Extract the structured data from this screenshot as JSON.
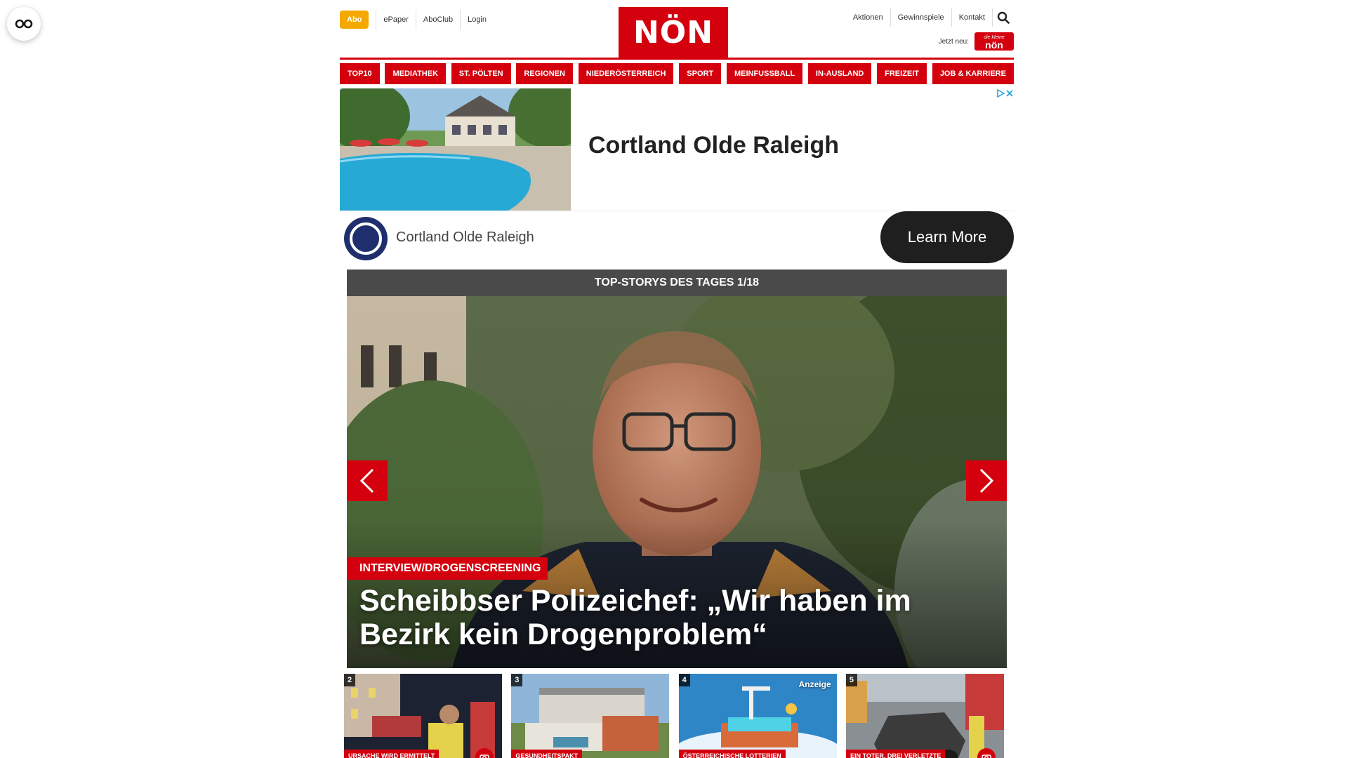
{
  "header": {
    "abo_label": "Abo",
    "left_links": [
      "ePaper",
      "AboClub",
      "Login"
    ],
    "logo_text": "NÖN",
    "right_links": [
      "Aktionen",
      "Gewinnspiele",
      "Kontakt"
    ],
    "jetzt_label": "Jetzt neu:",
    "jetzt_logo_top": "die kleine",
    "jetzt_logo_bottom": "nön"
  },
  "nav": {
    "items": [
      "TOP10",
      "MEDIATHEK",
      "ST. PÖLTEN",
      "REGIONEN",
      "NIEDERÖSTERREICH",
      "SPORT",
      "MEINFUSSBALL",
      "IN-AUSLAND",
      "FREIZEIT",
      "JOB & KARRIERE"
    ]
  },
  "ad": {
    "headline": "Cortland Olde Raleigh",
    "brand": "Cortland Olde Raleigh",
    "cta": "Learn More"
  },
  "top_stories": {
    "heading": "TOP-STORYS DES TAGES 1/18",
    "hero_tag": "INTERVIEW/DROGENSCREENING",
    "hero_title": "Scheibbser Polizeichef: „Wir haben im Bezirk kein Drogenproblem“",
    "thumbs": [
      {
        "num": "2",
        "caption": "URSACHE WIRD ERMITTELT",
        "ad_label": ""
      },
      {
        "num": "3",
        "caption": "GESUNDHEITSPAKT",
        "ad_label": ""
      },
      {
        "num": "4",
        "caption": "ÖSTERREICHISCHE LOTTERIEN",
        "ad_label": "Anzeige"
      },
      {
        "num": "5",
        "caption": "EIN TOTER, DREI VERLETZTE",
        "ad_label": ""
      }
    ]
  },
  "colors": {
    "brand_red": "#d4000e",
    "abo_orange": "#f5a800",
    "dark_bar": "#4a4a4a"
  }
}
